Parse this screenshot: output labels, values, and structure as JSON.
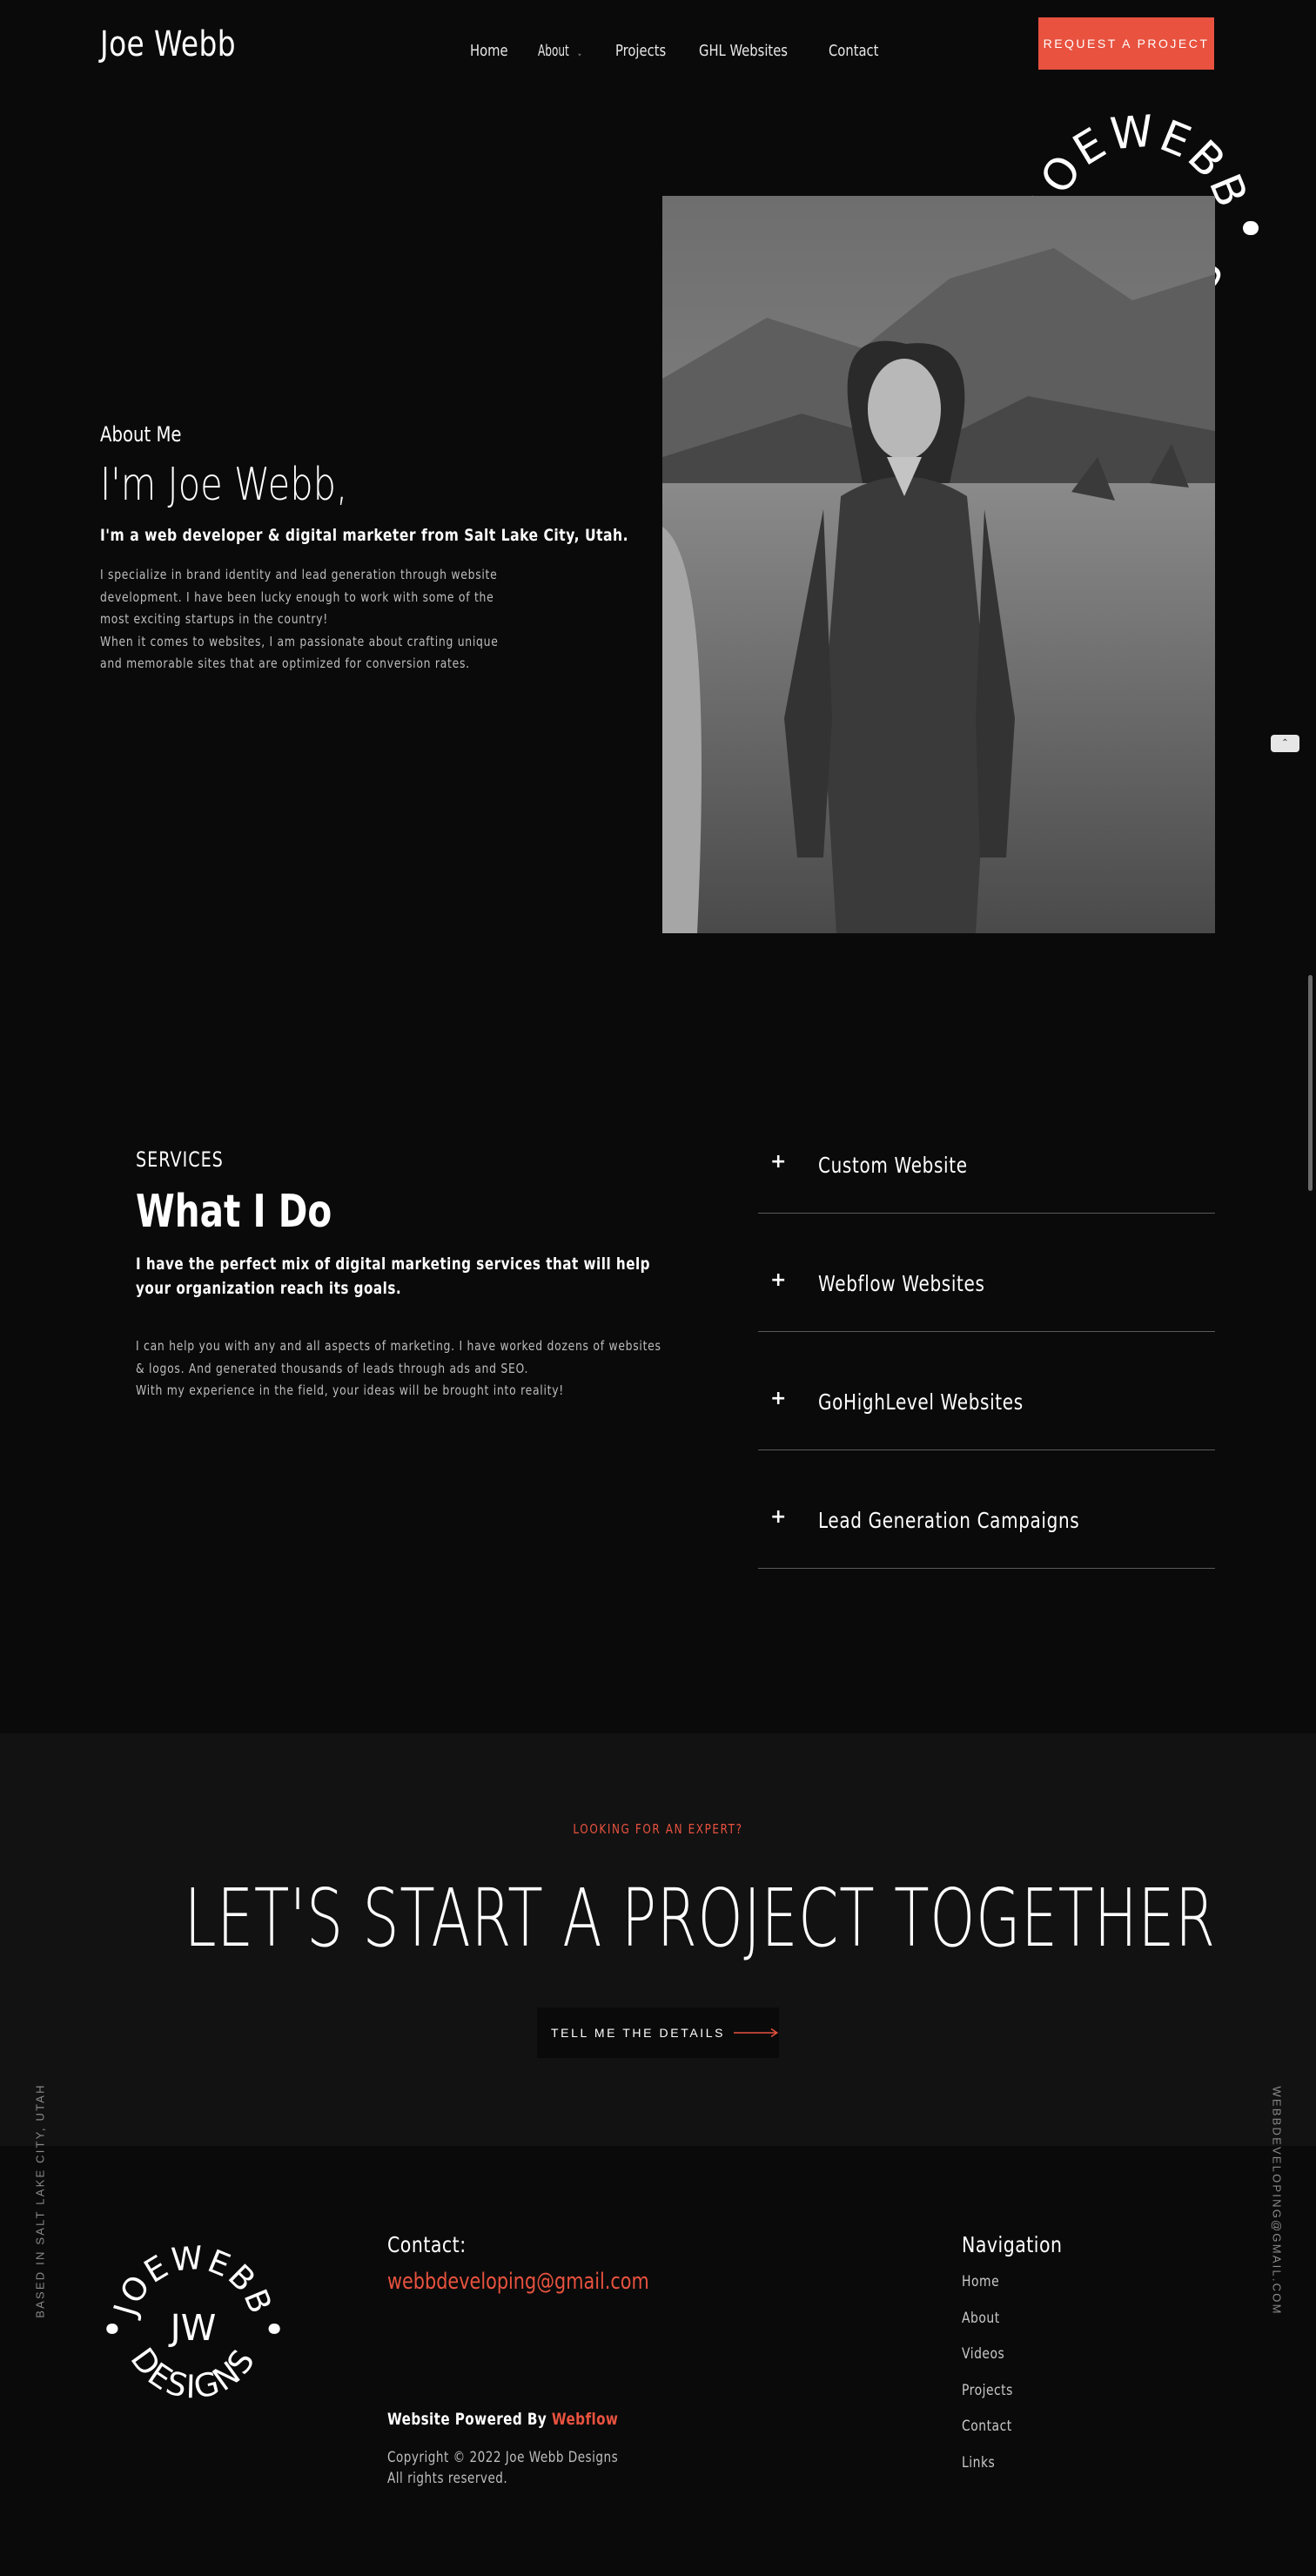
{
  "header": {
    "brand": "Joe Webb",
    "nav": [
      "Home",
      "About",
      "Projects",
      "GHL Websites",
      "Contact"
    ],
    "cta": "REQUEST A PROJECT"
  },
  "logo": {
    "ring": "JOEWEBB DESIGNS",
    "mark": "JW"
  },
  "about": {
    "eyebrow": "About Me",
    "title": "I'm Joe Webb,",
    "lead": "I'm a web developer & digital marketer from Salt Lake City, Utah.",
    "body1": "I specialize in brand identity and lead generation through website development. I have been lucky enough to work with some of the most exciting startups in the country!",
    "body2": "When it comes to websites, I am passionate about crafting unique and memorable sites that are optimized for conversion rates."
  },
  "services": {
    "eyebrow": "SERVICES",
    "title": "What I Do",
    "lead": "I have the perfect mix of digital marketing services that will help your organization reach its goals.",
    "body1": "I can help you with any and all aspects of marketing. I have worked dozens of websites & logos. And generated thousands of leads through ads and SEO.",
    "body2": "With my experience in the field, your ideas will be brought into reality!",
    "items": [
      "Custom Website",
      "Webflow Websites",
      "GoHighLevel Websites",
      "Lead Generation Campaigns"
    ]
  },
  "cta": {
    "eyebrow": "LOOKING FOR AN EXPERT?",
    "title": "LET'S START A PROJECT TOGETHER",
    "button": "TELL ME THE DETAILS"
  },
  "side": {
    "left": "BASED IN SALT LAKE CITY, UTAH",
    "right": "WEBBDEVELOPING@GMAIL.COM"
  },
  "footer": {
    "contact_heading": "Contact:",
    "email": "webbdeveloping@gmail.com",
    "powered_prefix": "Website Powered By",
    "powered_brand": "Webflow",
    "copyright": "Copyright © 2022 Joe Webb Designs",
    "rights": "All rights reserved.",
    "nav_heading": "Navigation",
    "nav": [
      "Home",
      "About",
      "Videos",
      "Projects",
      "Contact",
      "Links"
    ]
  },
  "colors": {
    "accent": "#e8523f",
    "background": "#0a0a0a",
    "band": "#121212"
  },
  "icons": {
    "about_chevron": "chevron-down-icon",
    "plus": "plus-icon",
    "arrow": "arrow-right-icon",
    "scroll_top": "chevron-up-icon"
  }
}
